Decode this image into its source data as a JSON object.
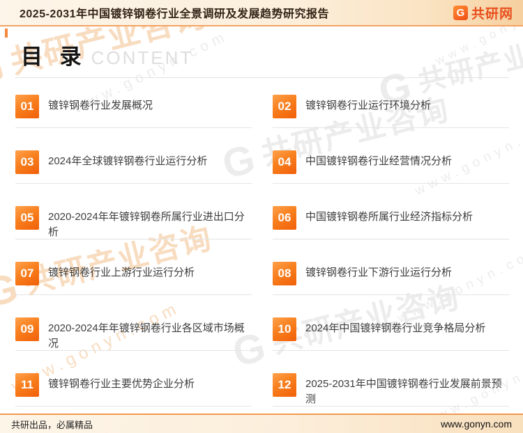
{
  "header": {
    "title": "2025-2031年中国镀锌钢卷行业全景调研及发展趋势研究报告",
    "logo": {
      "icon_letter": "G",
      "text": "共研网"
    }
  },
  "toc": {
    "heading_cn": "目 录",
    "heading_en": "CONTENT",
    "items": [
      {
        "num": "01",
        "label": "镀锌钢卷行业发展概况"
      },
      {
        "num": "02",
        "label": "镀锌钢卷行业运行环境分析"
      },
      {
        "num": "03",
        "label": "2024年全球镀锌钢卷行业运行分析"
      },
      {
        "num": "04",
        "label": "中国镀锌钢卷行业经营情况分析"
      },
      {
        "num": "05",
        "label": "2020-2024年年镀锌钢卷所属行业进出口分析"
      },
      {
        "num": "06",
        "label": "中国镀锌钢卷所属行业经济指标分析"
      },
      {
        "num": "07",
        "label": "镀锌钢卷行业上游行业运行分析"
      },
      {
        "num": "08",
        "label": "镀锌钢卷行业下游行业运行分析"
      },
      {
        "num": "09",
        "label": "2020-2024年年镀锌钢卷行业各区域市场概况"
      },
      {
        "num": "10",
        "label": "2024年中国镀锌钢卷行业竞争格局分析"
      },
      {
        "num": "11",
        "label": "镀锌钢卷行业主要优势企业分析"
      },
      {
        "num": "12",
        "label": "2025-2031年中国镀锌钢卷行业发展前景预测"
      }
    ]
  },
  "footer": {
    "left": "共研出品，必属精品",
    "right": "www.gonyn.com"
  },
  "watermark": {
    "g": "G",
    "logo_text": "共研产业咨询",
    "url_text": "www.gonyn.com"
  },
  "colors": {
    "accent_orange": "#f1600d",
    "logo_red": "#e8501e",
    "header_line": "#f3a261"
  }
}
